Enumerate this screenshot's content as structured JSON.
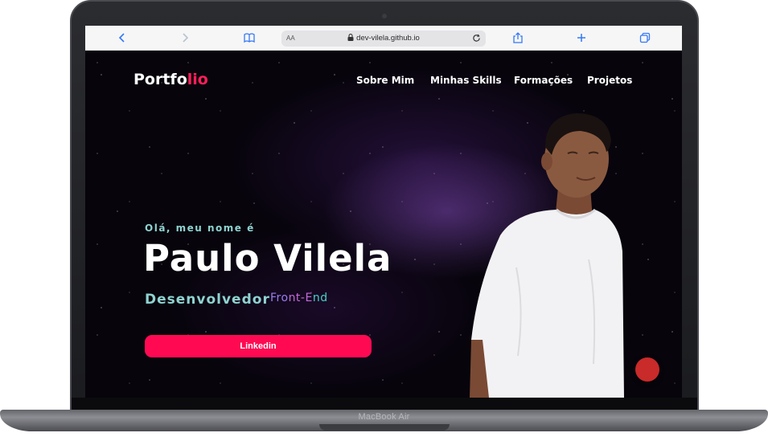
{
  "device": {
    "brand_label": "MacBook Air"
  },
  "browser": {
    "text_size_label": "AA",
    "url": "dev-vilela.github.io",
    "icons": [
      "back-icon",
      "forward-icon",
      "bookmarks-icon",
      "lock-icon",
      "reload-icon",
      "share-icon",
      "new-tab-icon",
      "tabs-icon"
    ]
  },
  "site": {
    "logo": {
      "main": "Portfo",
      "accent": "lio"
    },
    "nav": [
      "Sobre Mim",
      "Minhas Skills",
      "Formações",
      "Projetos"
    ],
    "hero": {
      "greeting": "Olá, meu nome é",
      "name": "Paulo Vilela",
      "role_main": "Desenvolvedor",
      "role_parts": [
        "Fro",
        "nt-E",
        "nd"
      ],
      "button": "Linkedin"
    }
  },
  "colors": {
    "accent": "#ff0a52",
    "teal": "#8fd3d0",
    "background": "#07040c",
    "fab": "#c92a2a"
  }
}
